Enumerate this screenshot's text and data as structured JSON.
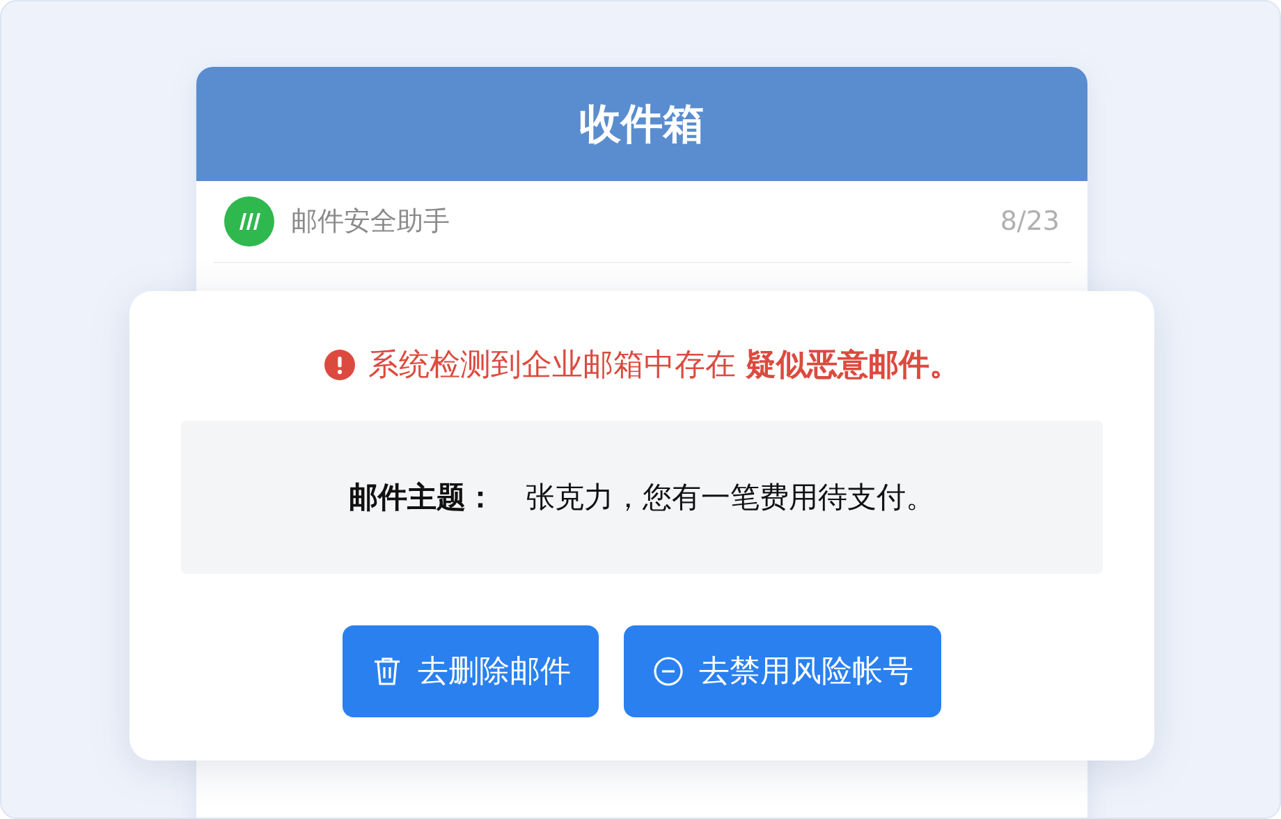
{
  "inbox": {
    "title": "收件箱",
    "message": {
      "sender": "邮件安全助手",
      "date": "8/23"
    }
  },
  "alert": {
    "warning": "系统检测到企业邮箱中存在 **疑似恶意邮件。**",
    "subject_label": "邮件主题：",
    "subject": "张克力，您有一笔费用待支付。",
    "buttons": [
      {
        "kind": "delete",
        "label": "去删除邮件"
      },
      {
        "kind": "disable",
        "label": "去禁用风险帐号"
      }
    ]
  }
}
